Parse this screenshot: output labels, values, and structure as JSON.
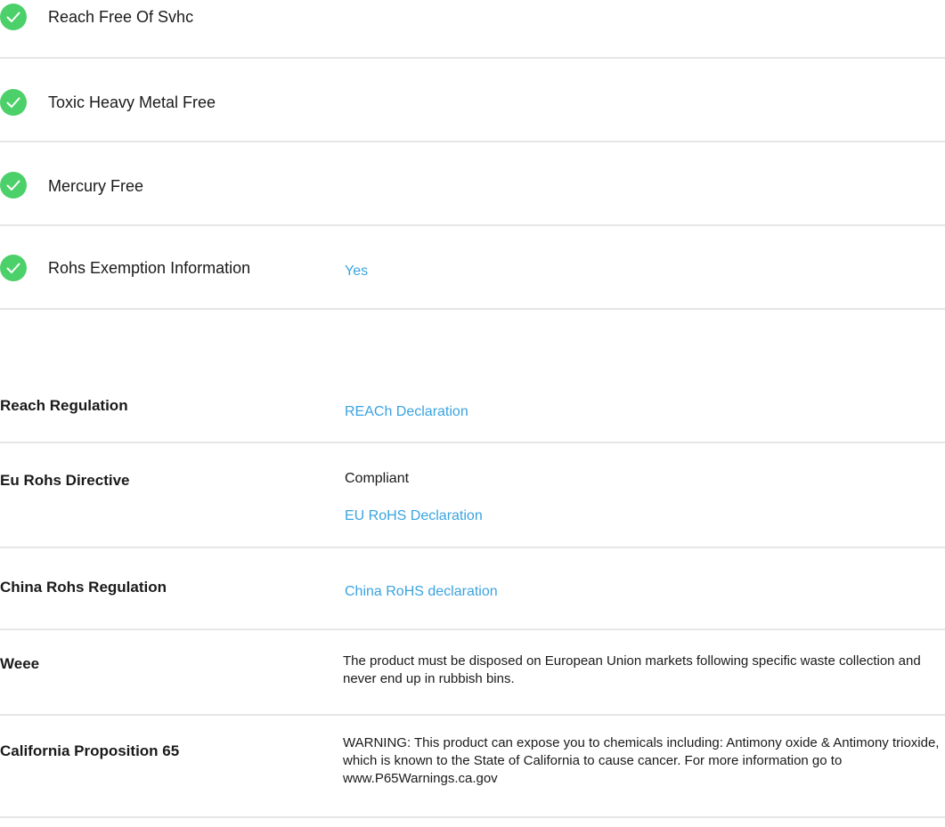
{
  "compliance_items": [
    {
      "label": "Reach Free Of Svhc",
      "value": ""
    },
    {
      "label": "Toxic Heavy Metal Free",
      "value": ""
    },
    {
      "label": "Mercury Free",
      "value": ""
    },
    {
      "label": "Rohs Exemption Information",
      "value": "Yes"
    }
  ],
  "regulations": {
    "reach": {
      "label": "Reach Regulation",
      "link": "REACh Declaration"
    },
    "eu_rohs": {
      "label": "Eu Rohs Directive",
      "status": "Compliant",
      "link": "EU RoHS Declaration"
    },
    "china_rohs": {
      "label": "China Rohs Regulation",
      "link": "China RoHS declaration"
    },
    "weee": {
      "label": "Weee",
      "text": "The product must be disposed on European Union markets following specific waste collection and never end up in rubbish bins."
    },
    "prop65": {
      "label": "California Proposition 65",
      "text": "WARNING: This product can expose you to chemicals including: Antimony oxide & Antimony trioxide, which is known to the State of California to cause cancer. For more information go to www.P65Warnings.ca.gov"
    }
  },
  "colors": {
    "check": "#4cd06a",
    "link": "#3aa3e0",
    "divider": "#e6e6e6"
  }
}
